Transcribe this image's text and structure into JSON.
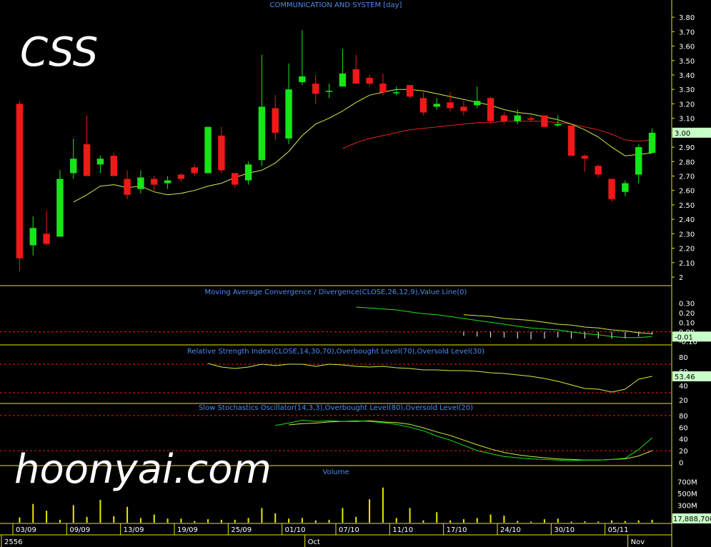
{
  "chart_data": {
    "type": "candlestick",
    "title": "COMMUNICATION AND SYSTEM [day]",
    "symbol": "CSS",
    "watermark": "hoonyai.com",
    "colors": {
      "up": "#18e418",
      "down": "#f01818",
      "ma_short": "#ccee44",
      "ma_long": "#e82020",
      "panel_line": "#e8e800",
      "panel_title": "#4a8cf0",
      "price_highlight": "#c8ffc8",
      "volume": "#e8e800"
    },
    "x_dates": [
      "03/09",
      "09/09",
      "13/09",
      "19/09",
      "25/09",
      "01/10",
      "07/10",
      "11/10",
      "17/10",
      "24/10",
      "30/10",
      "05/11"
    ],
    "x_months": [
      "2556",
      "Oct",
      "Nov"
    ],
    "price": {
      "ylim": [
        2.0,
        3.85
      ],
      "ticks": [
        "3.80",
        "3.70",
        "3.60",
        "3.50",
        "3.40",
        "3.30",
        "3.20",
        "3.10",
        "3.00",
        "2.90",
        "2.80",
        "2.70",
        "2.60",
        "2.50",
        "2.40",
        "2.30",
        "2.20",
        "2.10",
        "2"
      ],
      "last_value": "3.00",
      "candles": [
        {
          "o": 3.2,
          "h": 3.22,
          "l": 2.04,
          "c": 2.13
        },
        {
          "o": 2.22,
          "h": 2.42,
          "l": 2.15,
          "c": 2.34
        },
        {
          "o": 2.3,
          "h": 2.46,
          "l": 2.22,
          "c": 2.23
        },
        {
          "o": 2.28,
          "h": 2.74,
          "l": 2.28,
          "c": 2.68
        },
        {
          "o": 2.72,
          "h": 2.96,
          "l": 2.68,
          "c": 2.82
        },
        {
          "o": 2.92,
          "h": 3.12,
          "l": 2.7,
          "c": 2.7
        },
        {
          "o": 2.78,
          "h": 2.84,
          "l": 2.72,
          "c": 2.82
        },
        {
          "o": 2.84,
          "h": 2.86,
          "l": 2.7,
          "c": 2.7
        },
        {
          "o": 2.68,
          "h": 2.74,
          "l": 2.54,
          "c": 2.57
        },
        {
          "o": 2.61,
          "h": 2.74,
          "l": 2.58,
          "c": 2.69
        },
        {
          "o": 2.68,
          "h": 2.7,
          "l": 2.6,
          "c": 2.64
        },
        {
          "o": 2.65,
          "h": 2.7,
          "l": 2.61,
          "c": 2.67
        },
        {
          "o": 2.71,
          "h": 2.72,
          "l": 2.66,
          "c": 2.68
        },
        {
          "o": 2.76,
          "h": 2.78,
          "l": 2.7,
          "c": 2.72
        },
        {
          "o": 2.72,
          "h": 3.04,
          "l": 2.72,
          "c": 3.04
        },
        {
          "o": 2.98,
          "h": 3.04,
          "l": 2.72,
          "c": 2.74
        },
        {
          "o": 2.72,
          "h": 2.72,
          "l": 2.62,
          "c": 2.64
        },
        {
          "o": 2.67,
          "h": 2.8,
          "l": 2.64,
          "c": 2.78
        },
        {
          "o": 2.81,
          "h": 3.54,
          "l": 2.77,
          "c": 3.18
        },
        {
          "o": 3.17,
          "h": 3.26,
          "l": 2.95,
          "c": 3.0
        },
        {
          "o": 2.96,
          "h": 3.48,
          "l": 2.92,
          "c": 3.3
        },
        {
          "o": 3.35,
          "h": 3.71,
          "l": 3.33,
          "c": 3.39
        },
        {
          "o": 3.34,
          "h": 3.4,
          "l": 3.2,
          "c": 3.27
        },
        {
          "o": 3.29,
          "h": 3.34,
          "l": 3.24,
          "c": 3.29
        },
        {
          "o": 3.32,
          "h": 3.58,
          "l": 3.32,
          "c": 3.41
        },
        {
          "o": 3.44,
          "h": 3.54,
          "l": 3.34,
          "c": 3.34
        },
        {
          "o": 3.38,
          "h": 3.4,
          "l": 3.32,
          "c": 3.34
        },
        {
          "o": 3.34,
          "h": 3.41,
          "l": 3.26,
          "c": 3.28
        },
        {
          "o": 3.28,
          "h": 3.32,
          "l": 3.26,
          "c": 3.28
        },
        {
          "o": 3.33,
          "h": 3.33,
          "l": 3.24,
          "c": 3.25
        },
        {
          "o": 3.24,
          "h": 3.28,
          "l": 3.12,
          "c": 3.14
        },
        {
          "o": 3.18,
          "h": 3.24,
          "l": 3.16,
          "c": 3.2
        },
        {
          "o": 3.21,
          "h": 3.28,
          "l": 3.15,
          "c": 3.17
        },
        {
          "o": 3.18,
          "h": 3.22,
          "l": 3.12,
          "c": 3.15
        },
        {
          "o": 3.19,
          "h": 3.32,
          "l": 3.17,
          "c": 3.22
        },
        {
          "o": 3.24,
          "h": 3.25,
          "l": 3.06,
          "c": 3.08
        },
        {
          "o": 3.12,
          "h": 3.14,
          "l": 3.06,
          "c": 3.08
        },
        {
          "o": 3.08,
          "h": 3.16,
          "l": 3.06,
          "c": 3.12
        },
        {
          "o": 3.1,
          "h": 3.12,
          "l": 3.08,
          "c": 3.09
        },
        {
          "o": 3.12,
          "h": 3.12,
          "l": 3.04,
          "c": 3.04
        },
        {
          "o": 3.05,
          "h": 3.12,
          "l": 3.04,
          "c": 3.06
        },
        {
          "o": 3.05,
          "h": 3.05,
          "l": 2.84,
          "c": 2.84
        },
        {
          "o": 2.84,
          "h": 2.85,
          "l": 2.73,
          "c": 2.82
        },
        {
          "o": 2.77,
          "h": 2.78,
          "l": 2.69,
          "c": 2.71
        },
        {
          "o": 2.68,
          "h": 2.68,
          "l": 2.52,
          "c": 2.54
        },
        {
          "o": 2.59,
          "h": 2.67,
          "l": 2.56,
          "c": 2.65
        },
        {
          "o": 2.71,
          "h": 2.92,
          "l": 2.65,
          "c": 2.9
        },
        {
          "o": 2.86,
          "h": 3.03,
          "l": 2.86,
          "c": 3.0
        }
      ],
      "ma_short": [
        null,
        null,
        null,
        null,
        2.52,
        2.57,
        2.63,
        2.64,
        2.62,
        2.63,
        2.59,
        2.57,
        2.58,
        2.6,
        2.63,
        2.65,
        2.69,
        2.72,
        2.74,
        2.79,
        2.87,
        2.98,
        3.06,
        3.1,
        3.15,
        3.21,
        3.26,
        3.28,
        3.3,
        3.3,
        3.29,
        3.27,
        3.25,
        3.23,
        3.21,
        3.19,
        3.16,
        3.14,
        3.13,
        3.11,
        3.09,
        3.06,
        3.02,
        2.97,
        2.9,
        2.84,
        2.85,
        2.86
      ],
      "ma_long": [
        null,
        null,
        null,
        null,
        null,
        null,
        null,
        null,
        null,
        null,
        null,
        null,
        null,
        null,
        null,
        null,
        null,
        null,
        null,
        null,
        null,
        null,
        null,
        null,
        2.89,
        2.93,
        2.96,
        2.98,
        3.0,
        3.02,
        3.03,
        3.04,
        3.05,
        3.06,
        3.07,
        3.07,
        3.08,
        3.08,
        3.08,
        3.08,
        3.07,
        3.06,
        3.04,
        3.02,
        2.99,
        2.95,
        2.94,
        2.95
      ]
    },
    "macd": {
      "title": "Moving Average Convergence / Divergence(CLOSE,26,12,9),Value Line(0)",
      "ylim": [
        -0.1,
        0.35
      ],
      "ticks": [
        "0.30",
        "0.20",
        "0.10",
        "0.00",
        "-0.10"
      ],
      "last_value": "-0.01",
      "macd_line": [
        null,
        null,
        null,
        null,
        null,
        null,
        null,
        null,
        null,
        null,
        null,
        null,
        null,
        null,
        null,
        null,
        null,
        null,
        null,
        null,
        null,
        null,
        null,
        null,
        null,
        0.26,
        0.25,
        0.24,
        0.23,
        0.21,
        0.19,
        0.18,
        0.16,
        0.14,
        0.12,
        0.1,
        0.08,
        0.06,
        0.04,
        0.03,
        0.02,
        0.0,
        -0.02,
        -0.03,
        -0.05,
        -0.06,
        -0.06,
        -0.05
      ],
      "signal_line": [
        null,
        null,
        null,
        null,
        null,
        null,
        null,
        null,
        null,
        null,
        null,
        null,
        null,
        null,
        null,
        null,
        null,
        null,
        null,
        null,
        null,
        null,
        null,
        null,
        null,
        null,
        null,
        null,
        null,
        null,
        null,
        null,
        null,
        0.18,
        0.17,
        0.16,
        0.14,
        0.13,
        0.12,
        0.1,
        0.08,
        0.07,
        0.05,
        0.04,
        0.02,
        0.01,
        -0.01,
        -0.02
      ],
      "histogram": [
        null,
        null,
        null,
        null,
        null,
        null,
        null,
        null,
        null,
        null,
        null,
        null,
        null,
        null,
        null,
        null,
        null,
        null,
        null,
        null,
        null,
        null,
        null,
        null,
        null,
        null,
        null,
        null,
        null,
        null,
        null,
        null,
        null,
        -0.04,
        -0.05,
        -0.06,
        -0.06,
        -0.07,
        -0.08,
        -0.07,
        -0.06,
        -0.07,
        -0.07,
        -0.07,
        -0.07,
        -0.07,
        -0.05,
        -0.03
      ]
    },
    "rsi": {
      "title": "Relative Strength Index(CLOSE,14,30,70),Overbought Level(70),Oversold Level(30)",
      "ylim": [
        18,
        90
      ],
      "ticks": [
        "80",
        "60",
        "40",
        "20"
      ],
      "overbought": 70,
      "oversold": 30,
      "last_value": "53.46",
      "values": [
        null,
        null,
        null,
        null,
        null,
        null,
        null,
        null,
        null,
        null,
        null,
        null,
        null,
        null,
        71,
        66,
        64,
        66,
        70,
        68,
        70,
        70,
        67,
        70,
        69,
        67,
        66,
        67,
        65,
        64,
        62,
        62,
        61,
        61,
        60,
        58,
        57,
        55,
        53,
        50,
        46,
        41,
        36,
        35,
        31,
        35,
        49,
        53
      ]
    },
    "stoch": {
      "title": "Slow Stochastics Oscillator(14,3,3),Overbought Level(80),Oversold Level(20)",
      "ylim": [
        -3,
        92
      ],
      "ticks": [
        "80",
        "60",
        "40",
        "20",
        "0"
      ],
      "overbought": 80,
      "oversold": 20,
      "k_line": [
        null,
        null,
        null,
        null,
        null,
        null,
        null,
        null,
        null,
        null,
        null,
        null,
        null,
        null,
        null,
        null,
        null,
        null,
        null,
        63,
        67,
        72,
        70,
        71,
        70,
        71,
        70,
        68,
        65,
        60,
        54,
        45,
        38,
        29,
        20,
        15,
        10,
        8,
        6,
        5,
        4,
        3,
        4,
        4,
        5,
        7,
        22,
        42
      ],
      "d_line": [
        null,
        null,
        null,
        null,
        null,
        null,
        null,
        null,
        null,
        null,
        null,
        null,
        null,
        null,
        null,
        null,
        null,
        null,
        null,
        null,
        64,
        66,
        67,
        69,
        70,
        70,
        71,
        69,
        68,
        65,
        59,
        52,
        46,
        38,
        30,
        23,
        17,
        13,
        10,
        8,
        6,
        5,
        4,
        4,
        5,
        6,
        11,
        20
      ]
    },
    "volume": {
      "title": "Volume",
      "ylim": [
        0,
        780
      ],
      "ticks": [
        "700M",
        "500M",
        "300M",
        "100M"
      ],
      "last_value": "17,888,700",
      "values": [
        90,
        320,
        205,
        50,
        300,
        100,
        390,
        110,
        270,
        80,
        140,
        70,
        70,
        30,
        60,
        50,
        50,
        80,
        250,
        160,
        70,
        80,
        40,
        50,
        250,
        100,
        400,
        600,
        80,
        250,
        40,
        180,
        40,
        60,
        80,
        140,
        120,
        30,
        20,
        60,
        70,
        20,
        25,
        20,
        40,
        30,
        40,
        50
      ]
    }
  }
}
